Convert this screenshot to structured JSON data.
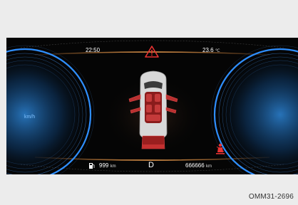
{
  "cluster": {
    "clock": "22:50",
    "outside_temp": "23.6",
    "temp_unit": "℃",
    "speed_unit": "km/h",
    "range_value": "999",
    "range_unit": "km",
    "gear": "D",
    "odometer_value": "666666",
    "odometer_unit": "km",
    "icons": {
      "warning": "warning-triangle-icon",
      "fuel": "fuel-pump-icon",
      "seatbelt": "seatbelt-warning-icon",
      "car": "car-doors-open-icon"
    },
    "colors": {
      "accent_orange": "#e08a3c",
      "gauge_blue": "#2f8fff",
      "warning_red": "#e83232",
      "background": "#050505"
    }
  },
  "figure_code": "OMM31-2696"
}
